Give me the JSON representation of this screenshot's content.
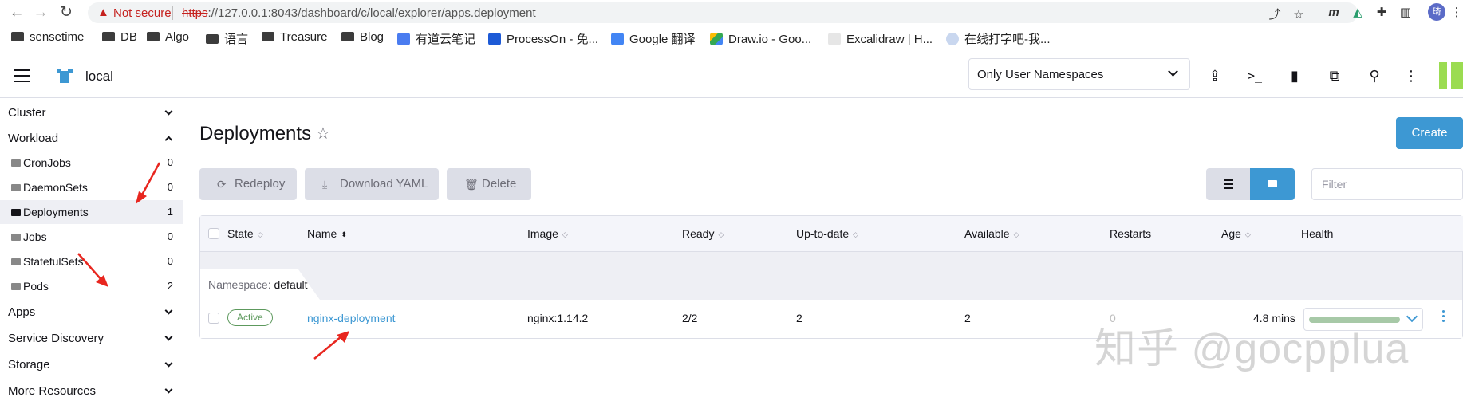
{
  "browser": {
    "warning": "Not secure",
    "url_scheme": "https",
    "url_rest": "://127.0.0.1:8043/dashboard/c/local/explorer/apps.deployment",
    "profile_initial": "琦",
    "bookmarks": [
      {
        "label": "sensetime",
        "icon": "folder-icon"
      },
      {
        "label": "DB",
        "icon": "folder-icon"
      },
      {
        "label": "Algo",
        "icon": "folder-icon"
      },
      {
        "label": "语言",
        "icon": "folder-icon"
      },
      {
        "label": "Treasure",
        "icon": "folder-icon"
      },
      {
        "label": "Blog",
        "icon": "folder-icon"
      },
      {
        "label": "有道云笔记",
        "icon": "youdao-icon"
      },
      {
        "label": "ProcessOn - 免...",
        "icon": "processon-icon"
      },
      {
        "label": "Google 翻译",
        "icon": "google-translate-icon"
      },
      {
        "label": "Draw.io - Goo...",
        "icon": "drive-icon"
      },
      {
        "label": "Excalidraw | H...",
        "icon": "excalidraw-icon"
      },
      {
        "label": "在线打字吧-我...",
        "icon": "typing-icon"
      }
    ]
  },
  "header": {
    "cluster_name": "local",
    "namespace_filter": "Only User Namespaces"
  },
  "sidebar": {
    "groups": [
      {
        "label": "Cluster"
      },
      {
        "label": "Workload"
      },
      {
        "label": "Apps"
      },
      {
        "label": "Service Discovery"
      },
      {
        "label": "Storage"
      },
      {
        "label": "More Resources"
      }
    ],
    "workload_items": [
      {
        "label": "CronJobs",
        "count": "0"
      },
      {
        "label": "DaemonSets",
        "count": "0"
      },
      {
        "label": "Deployments",
        "count": "1"
      },
      {
        "label": "Jobs",
        "count": "0"
      },
      {
        "label": "StatefulSets",
        "count": "0"
      },
      {
        "label": "Pods",
        "count": "2"
      }
    ]
  },
  "main": {
    "title": "Deployments",
    "create_label": "Create",
    "actions": {
      "redeploy": "Redeploy",
      "download": "Download YAML",
      "delete": "Delete"
    },
    "filter_placeholder": "Filter",
    "columns": [
      "State",
      "Name",
      "Image",
      "Ready",
      "Up-to-date",
      "Available",
      "Restarts",
      "Age",
      "Health"
    ],
    "group": {
      "prefix": "Namespace:",
      "name": "default"
    },
    "rows": [
      {
        "state": "Active",
        "name": "nginx-deployment",
        "image": "nginx:1.14.2",
        "ready": "2/2",
        "up_to_date": "2",
        "available": "2",
        "restarts": "0",
        "age": "4.8 mins",
        "health": 1.0
      }
    ]
  },
  "watermark": "知乎 @gocpplua",
  "colors": {
    "accent": "#3d98d3",
    "active_green": "#5d995d",
    "arrow_red": "#e8261f"
  }
}
